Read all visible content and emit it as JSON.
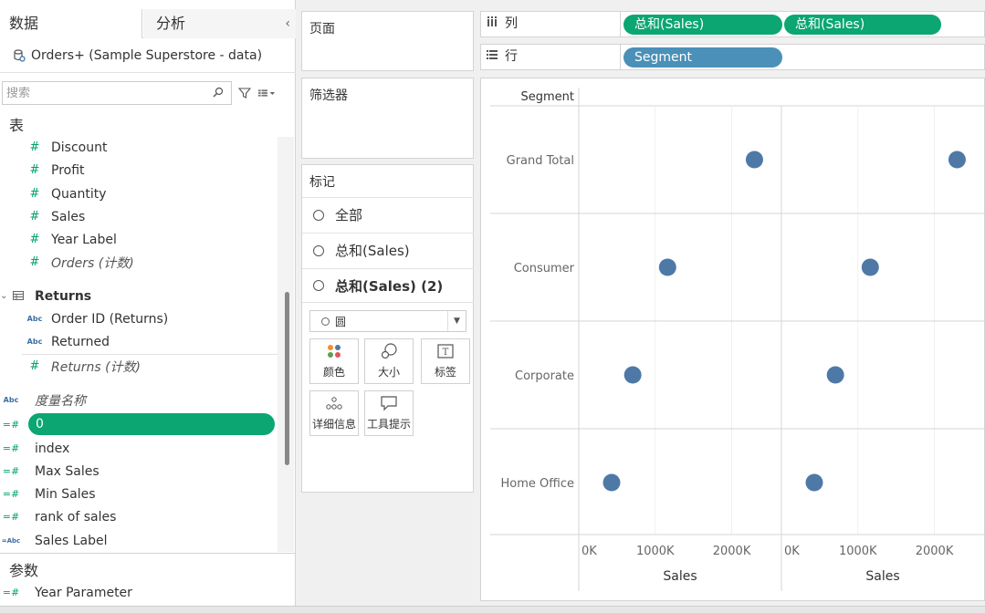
{
  "data_pane": {
    "tab_data": "数据",
    "tab_analysis": "分析",
    "collapse_glyph": "‹",
    "datasource": "Orders+ (Sample Superstore - data)",
    "search_placeholder": "搜索",
    "section_tables": "表",
    "orders_fields": [
      {
        "label": "Discount",
        "type": "measure"
      },
      {
        "label": "Profit",
        "type": "measure"
      },
      {
        "label": "Quantity",
        "type": "measure"
      },
      {
        "label": "Sales",
        "type": "measure"
      },
      {
        "label": "Year Label",
        "type": "measure"
      },
      {
        "label": "Orders (计数)",
        "type": "count"
      }
    ],
    "returns_table": "Returns",
    "returns_fields": [
      {
        "label": "Order ID (Returns)",
        "type": "dimension",
        "icon": "Abc"
      },
      {
        "label": "Returned",
        "type": "dimension",
        "icon": "Abc"
      },
      {
        "label": "Returns (计数)",
        "type": "count"
      }
    ],
    "measure_names": "度量名称",
    "selected_field": "0",
    "calc_fields": [
      {
        "label": "index"
      },
      {
        "label": "Max Sales"
      },
      {
        "label": "Min Sales"
      },
      {
        "label": "rank of sales"
      },
      {
        "label": "Sales Label"
      }
    ],
    "section_params": "参数",
    "params": [
      {
        "label": "Year Parameter"
      }
    ]
  },
  "cards": {
    "pages": "页面",
    "filters": "筛选器",
    "marks": "标记",
    "marks_rows": [
      "全部",
      "总和(Sales)",
      "总和(Sales) (2)"
    ],
    "mark_type": "圆",
    "mark_buttons": [
      "颜色",
      "大小",
      "标签",
      "详细信息",
      "工具提示"
    ]
  },
  "shelves": {
    "columns_label": "列",
    "rows_label": "行",
    "column_pills": [
      "总和(Sales)",
      "总和(Sales)"
    ],
    "row_pills": [
      "Segment"
    ]
  },
  "colors": {
    "pill_green": "#0ba671",
    "pill_blue": "#4a90b8",
    "mark": "#4e79a7"
  },
  "chart_data": {
    "type": "scatter",
    "row_header": "Segment",
    "categories": [
      "Grand Total",
      "Consumer",
      "Corporate",
      "Home Office"
    ],
    "series": [
      {
        "values": [
          2297201,
          1161401,
          706146,
          429653
        ]
      },
      {
        "values": [
          2297201,
          1161401,
          706146,
          429653
        ]
      }
    ],
    "x_ticks": [
      "0K",
      "1000K",
      "2000K"
    ],
    "x_tick_values": [
      0,
      1000000,
      2000000
    ],
    "xlim": [
      0,
      2650000
    ],
    "xlabel": "Sales",
    "grid": true
  }
}
